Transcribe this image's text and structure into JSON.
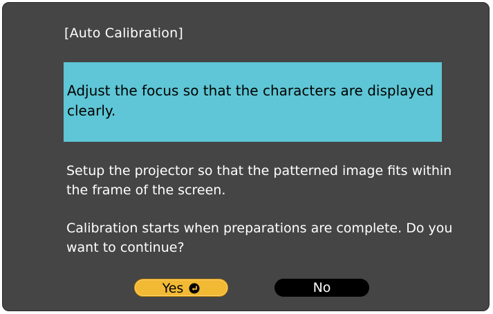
{
  "dialog": {
    "title": "[Auto Calibration]",
    "notice": "Adjust the focus so that the characters are displayed clearly.",
    "instruction": "Setup the projector so that the patterned image fits within the frame of the screen.",
    "question": "Calibration starts when preparations are complete. Do you want to continue?"
  },
  "buttons": {
    "yes_label": "Yes",
    "yes_icon": "enter-icon",
    "no_label": "No"
  },
  "colors": {
    "dialog_background": "#454545",
    "notice_background": "#5ec6d6",
    "yes_button": "#f2b935",
    "no_button": "#000000"
  }
}
